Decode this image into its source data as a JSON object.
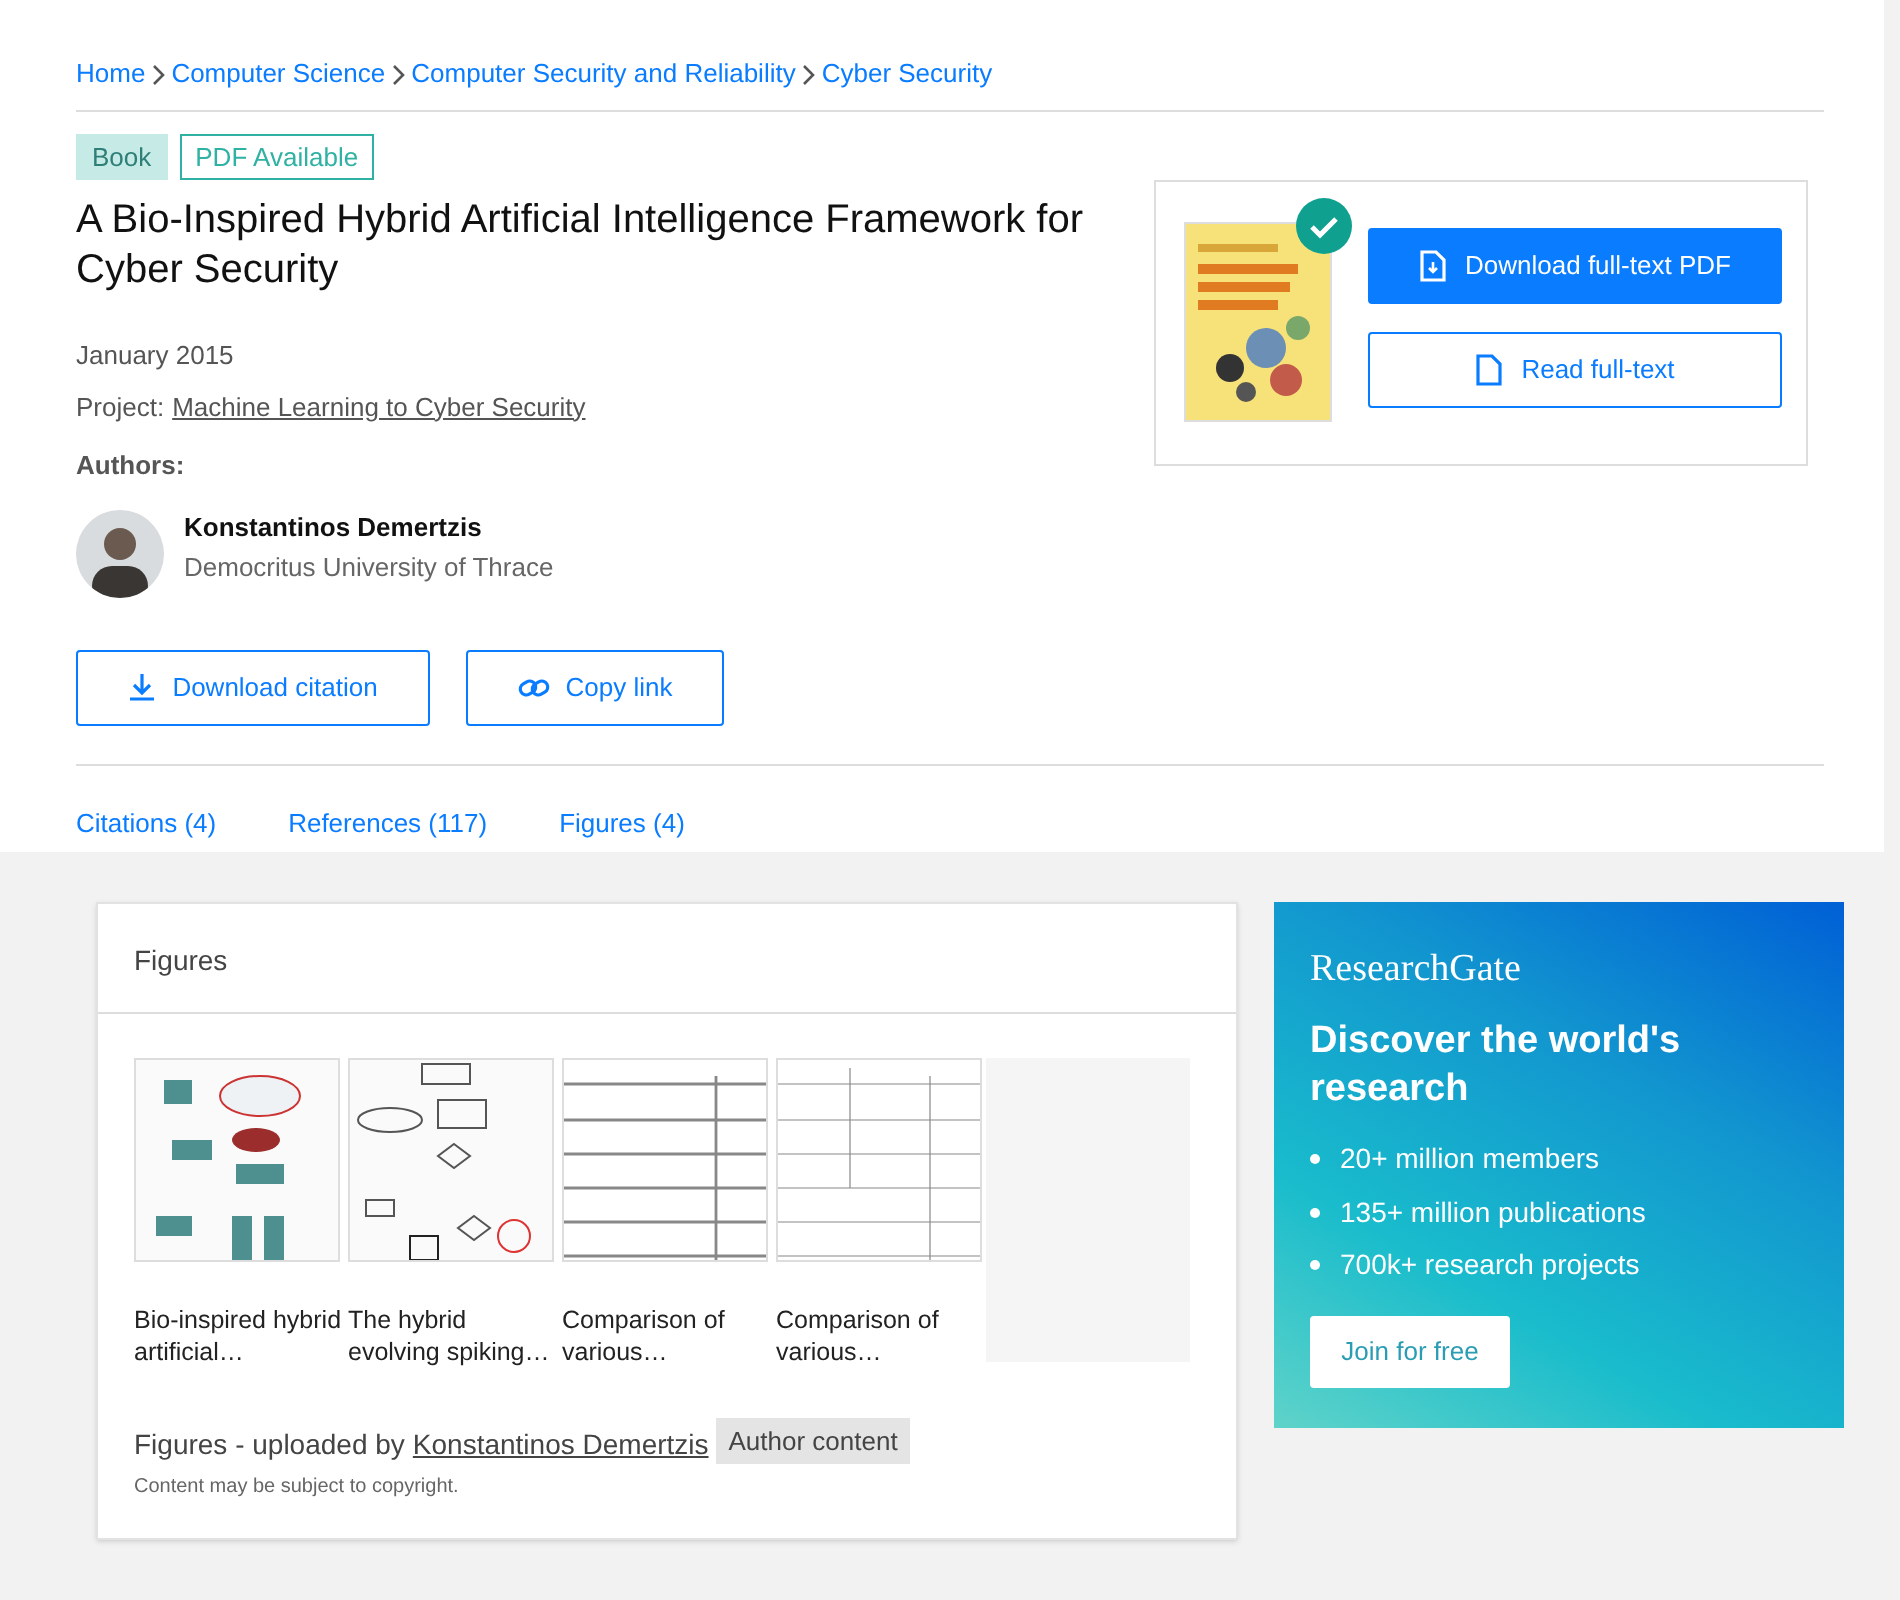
{
  "breadcrumbs": [
    "Home",
    "Computer Science",
    "Computer Security and Reliability",
    "Cyber Security"
  ],
  "badges": [
    {
      "label": "Book",
      "kind": "filled"
    },
    {
      "label": "PDF Available",
      "kind": "outline"
    }
  ],
  "title": "A Bio-Inspired Hybrid Artificial Intelligence Framework for Cyber Security",
  "date": "January 2015",
  "project": {
    "label": "Project:",
    "link": "Machine Learning to Cyber Security"
  },
  "authors_label": "Authors:",
  "authors": [
    {
      "name": "Konstantinos Demertzis",
      "affiliation": "Democritus University of Thrace"
    }
  ],
  "actions": [
    {
      "label": "Download citation",
      "kind": "download"
    },
    {
      "label": "Copy link",
      "kind": "link"
    }
  ],
  "full_text": {
    "verified": true,
    "buttons": [
      {
        "label": "Download full-text PDF",
        "kind": "primary"
      },
      {
        "label": "Read full-text",
        "kind": "secondary"
      }
    ]
  },
  "section_links": [
    "Citations (4)",
    "References (117)",
    "Figures (4)"
  ],
  "figures_panel": {
    "title": "Figures",
    "items": [
      {
        "kind": "figure",
        "caption": "Bio-inspired hybrid artificial…"
      },
      {
        "kind": "figure",
        "caption": "The hybrid evolving spiking…"
      },
      {
        "kind": "figure",
        "caption": "Comparison of various…"
      },
      {
        "kind": "figure",
        "caption": "Comparison of various…"
      },
      {
        "kind": "placeholder"
      }
    ],
    "uploaded_label": "Figures - uploaded by",
    "uploader": "Konstantinos Demertzis",
    "content_badge": "Author content",
    "note": "Content may be subject to copyright."
  },
  "promo": {
    "brand": "ResearchGate",
    "heading": "Discover the world's research",
    "bullets": [
      "20+ million members",
      "135+ million publications",
      "700k+ research projects"
    ],
    "button": "Join for free"
  }
}
